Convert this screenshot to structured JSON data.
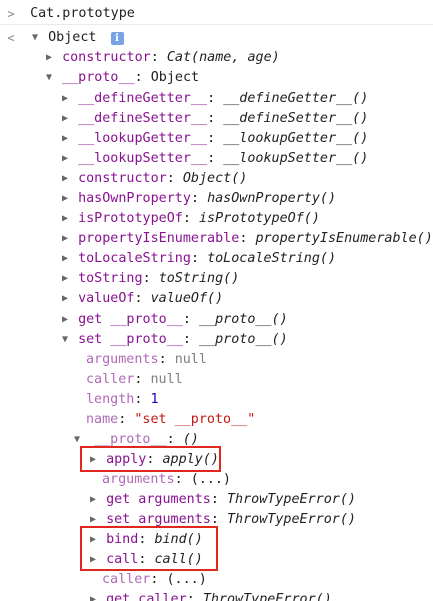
{
  "console": {
    "input_prompt": ">",
    "input_expression": "Cat.prototype",
    "result_prompt": "<",
    "root_label": "Object",
    "info_badge": "i"
  },
  "tree": {
    "constructor": {
      "key": "constructor",
      "sep": ": ",
      "value": "Cat(name, age)"
    },
    "proto": {
      "key": "__proto__",
      "sep": ": ",
      "value": "Object"
    },
    "defineGetter": {
      "key": "__defineGetter__",
      "sep": ": ",
      "value": "__defineGetter__()"
    },
    "defineSetter": {
      "key": "__defineSetter__",
      "sep": ": ",
      "value": "__defineSetter__()"
    },
    "lookupGetter": {
      "key": "__lookupGetter__",
      "sep": ": ",
      "value": "__lookupGetter__()"
    },
    "lookupSetter": {
      "key": "__lookupSetter__",
      "sep": ": ",
      "value": "__lookupSetter__()"
    },
    "objConstructor": {
      "key": "constructor",
      "sep": ": ",
      "value": "Object()"
    },
    "hasOwnProperty": {
      "key": "hasOwnProperty",
      "sep": ": ",
      "value": "hasOwnProperty()"
    },
    "isPrototypeOf": {
      "key": "isPrototypeOf",
      "sep": ": ",
      "value": "isPrototypeOf()"
    },
    "propertyIsEnumerable": {
      "key": "propertyIsEnumerable",
      "sep": ": ",
      "value": "propertyIsEnumerable()"
    },
    "toLocaleString": {
      "key": "toLocaleString",
      "sep": ": ",
      "value": "toLocaleString()"
    },
    "toString": {
      "key": "toString",
      "sep": ": ",
      "value": "toString()"
    },
    "valueOf": {
      "key": "valueOf",
      "sep": ": ",
      "value": "valueOf()"
    },
    "getProto": {
      "key": "get __proto__",
      "sep": ": ",
      "value": "__proto__()"
    },
    "setProto": {
      "key": "set __proto__",
      "sep": ": ",
      "value": "__proto__()"
    },
    "arguments": {
      "key": "arguments",
      "sep": ": ",
      "value": "null"
    },
    "caller": {
      "key": "caller",
      "sep": ": ",
      "value": "null"
    },
    "length": {
      "key": "length",
      "sep": ": ",
      "value": "1"
    },
    "name": {
      "key": "name",
      "sep": ": ",
      "value": "\"set __proto__\""
    },
    "innerProto": {
      "key": "__proto__",
      "sep": ": ",
      "value": "()"
    },
    "apply": {
      "key": "apply",
      "sep": ": ",
      "value": "apply()"
    },
    "innerArguments": {
      "key": "arguments",
      "sep": ": ",
      "value": "(...)"
    },
    "getArguments": {
      "key": "get arguments",
      "sep": ": ",
      "value": "ThrowTypeError()"
    },
    "setArguments": {
      "key": "set arguments",
      "sep": ": ",
      "value": "ThrowTypeError()"
    },
    "bind": {
      "key": "bind",
      "sep": ": ",
      "value": "bind()"
    },
    "call": {
      "key": "call",
      "sep": ": ",
      "value": "call()"
    },
    "innerCaller": {
      "key": "caller",
      "sep": ": ",
      "value": "(...)"
    },
    "getCaller": {
      "key": "get caller",
      "sep": ": ",
      "value": "ThrowTypeError()"
    }
  },
  "colors": {
    "property_key": "#881391",
    "string_value": "#c41a16",
    "number_value": "#1c00cf",
    "null_value": "#808080",
    "info_badge": "#7aa3e6",
    "highlight_border": "#e0281f"
  }
}
